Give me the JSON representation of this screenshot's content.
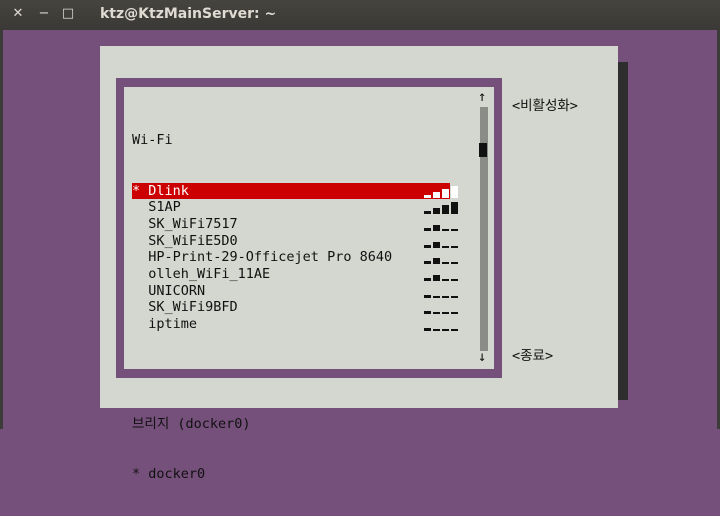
{
  "window": {
    "title": "ktz@KtzMainServer: ~",
    "close_glyph": "✕",
    "minimize_glyph": "−",
    "maximize_glyph": "□"
  },
  "list": {
    "wifi_header": "Wi-Fi",
    "networks": [
      {
        "label": "* Dlink",
        "signal": 4
      },
      {
        "label": "  S1AP",
        "signal": 4
      },
      {
        "label": "  SK_WiFi7517",
        "signal": 2
      },
      {
        "label": "  SK_WiFiE5D0",
        "signal": 2
      },
      {
        "label": "  HP-Print-29-Officejet Pro 8640",
        "signal": 2
      },
      {
        "label": "  olleh_WiFi_11AE",
        "signal": 2
      },
      {
        "label": "  UNICORN",
        "signal": 1
      },
      {
        "label": "  SK_WiFi9BFD",
        "signal": 1
      },
      {
        "label": "  iptime",
        "signal": 1
      }
    ],
    "bridge_header": "브리지 (docker0)",
    "bridge_item": "* docker0",
    "scroll_up": "↑",
    "scroll_down": "↓"
  },
  "buttons": {
    "deactivate": "<비활성화>",
    "quit": "<종료>"
  }
}
